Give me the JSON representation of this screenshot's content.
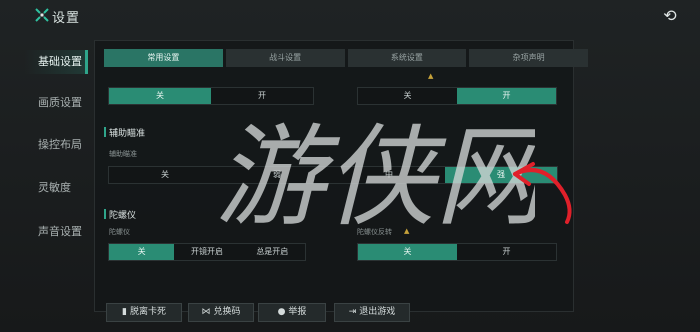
{
  "window": {
    "title": "设置",
    "logo_icon": "x-logo-icon",
    "refresh_icon": "refresh-icon"
  },
  "nav": {
    "items": [
      {
        "label": "基础设置",
        "active": true
      },
      {
        "label": "画质设置",
        "active": false
      },
      {
        "label": "操控布局",
        "active": false
      },
      {
        "label": "灵敏度",
        "active": false
      },
      {
        "label": "声音设置",
        "active": false
      }
    ]
  },
  "tabs": [
    {
      "label": "常用设置",
      "active": true
    },
    {
      "label": "战斗设置",
      "active": false
    },
    {
      "label": "系统设置",
      "active": false
    },
    {
      "label": "杂项声明",
      "active": false
    }
  ],
  "top_row": {
    "left_options": [
      "关",
      "开"
    ],
    "right_options": [
      "关",
      "开"
    ]
  },
  "aim_assist": {
    "title": "辅助瞄准",
    "sub_label": "辅助瞄准",
    "options": [
      "关",
      "弱",
      "中",
      "强"
    ]
  },
  "gyro": {
    "title": "陀螺仪",
    "left_label": "陀螺仪",
    "left_options": [
      "关",
      "开镜开启",
      "总是开启"
    ],
    "right_label": "陀螺仪反转",
    "right_options": [
      "关",
      "开"
    ]
  },
  "buttons": {
    "unstuck": "脱离卡死",
    "redeem": "兑换码",
    "report": "举报",
    "exit": "退出游戏"
  },
  "watermark": "游侠网",
  "colors": {
    "accent": "#2a8c74",
    "arrow": "#e0202a"
  }
}
